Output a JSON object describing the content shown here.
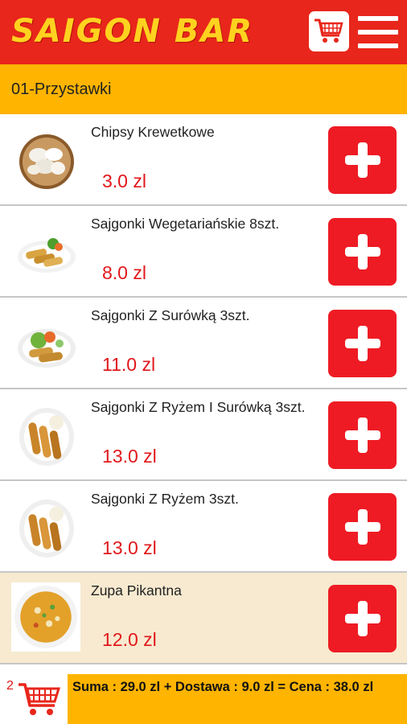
{
  "header": {
    "title": "SAIGON BAR",
    "cart_icon": "shopping-cart-icon",
    "menu_icon": "hamburger-menu-icon",
    "accent": "#e8261b",
    "title_color": "#ffd21f"
  },
  "category": {
    "label": "01-Przystawki",
    "color": "#ffb400"
  },
  "items": [
    {
      "name": "Chipsy  Krewetkowe",
      "price": "3.0 zl",
      "image": "shrimp-chips-photo"
    },
    {
      "name": "Sajgonki Wegetariańskie 8szt.",
      "price": "8.0 zl",
      "image": "vegetarian-spring-rolls-photo"
    },
    {
      "name": "Sajgonki Z Surówką 3szt.",
      "price": "11.0 zl",
      "image": "spring-rolls-salad-photo"
    },
    {
      "name": "Sajgonki Z Ryżem I Surówką 3szt.",
      "price": "13.0 zl",
      "image": "spring-rolls-rice-salad-photo"
    },
    {
      "name": "Sajgonki Z Ryżem 3szt.",
      "price": "13.0 zl",
      "image": "spring-rolls-rice-photo"
    },
    {
      "name": "Zupa Pikantna",
      "price": "12.0 zl",
      "image": "spicy-soup-photo"
    }
  ],
  "add_icon": "plus-icon",
  "add_color": "#ee1b24",
  "price_color": "#e1171b",
  "footer": {
    "cart_count": "2",
    "summary": "Suma : 29.0 zl  +  Dostawa  : 9.0 zl  =  Cena : 38.0 zl"
  }
}
